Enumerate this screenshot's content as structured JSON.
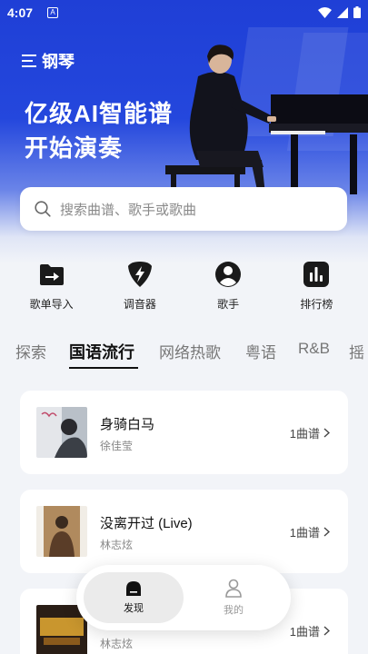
{
  "status": {
    "time": "4:07",
    "notif": "A"
  },
  "header": {
    "brand": "钢琴",
    "headline_line1": "亿级AI智能谱",
    "headline_line2": "开始演奏"
  },
  "search": {
    "placeholder": "搜索曲谱、歌手或歌曲"
  },
  "quick_actions": [
    {
      "label": "歌单导入",
      "icon": "import-icon"
    },
    {
      "label": "调音器",
      "icon": "tuner-icon"
    },
    {
      "label": "歌手",
      "icon": "singer-icon"
    },
    {
      "label": "排行榜",
      "icon": "ranking-icon"
    }
  ],
  "tabs": [
    "探索",
    "国语流行",
    "网络热歌",
    "粤语",
    "R&B",
    "摇"
  ],
  "active_tab": "国语流行",
  "songs": [
    {
      "title": "身骑白马",
      "artist": "徐佳莹",
      "count": "1曲谱"
    },
    {
      "title": "没离开过 (Live)",
      "artist": "林志炫",
      "count": "1曲谱"
    },
    {
      "title": "",
      "artist": "林志炫",
      "count": "1曲谱"
    }
  ],
  "bottom_nav": {
    "discover": "发现",
    "mine": "我的"
  },
  "colors": {
    "brand_blue": "#2447dd",
    "background": "#f2f4f8"
  }
}
